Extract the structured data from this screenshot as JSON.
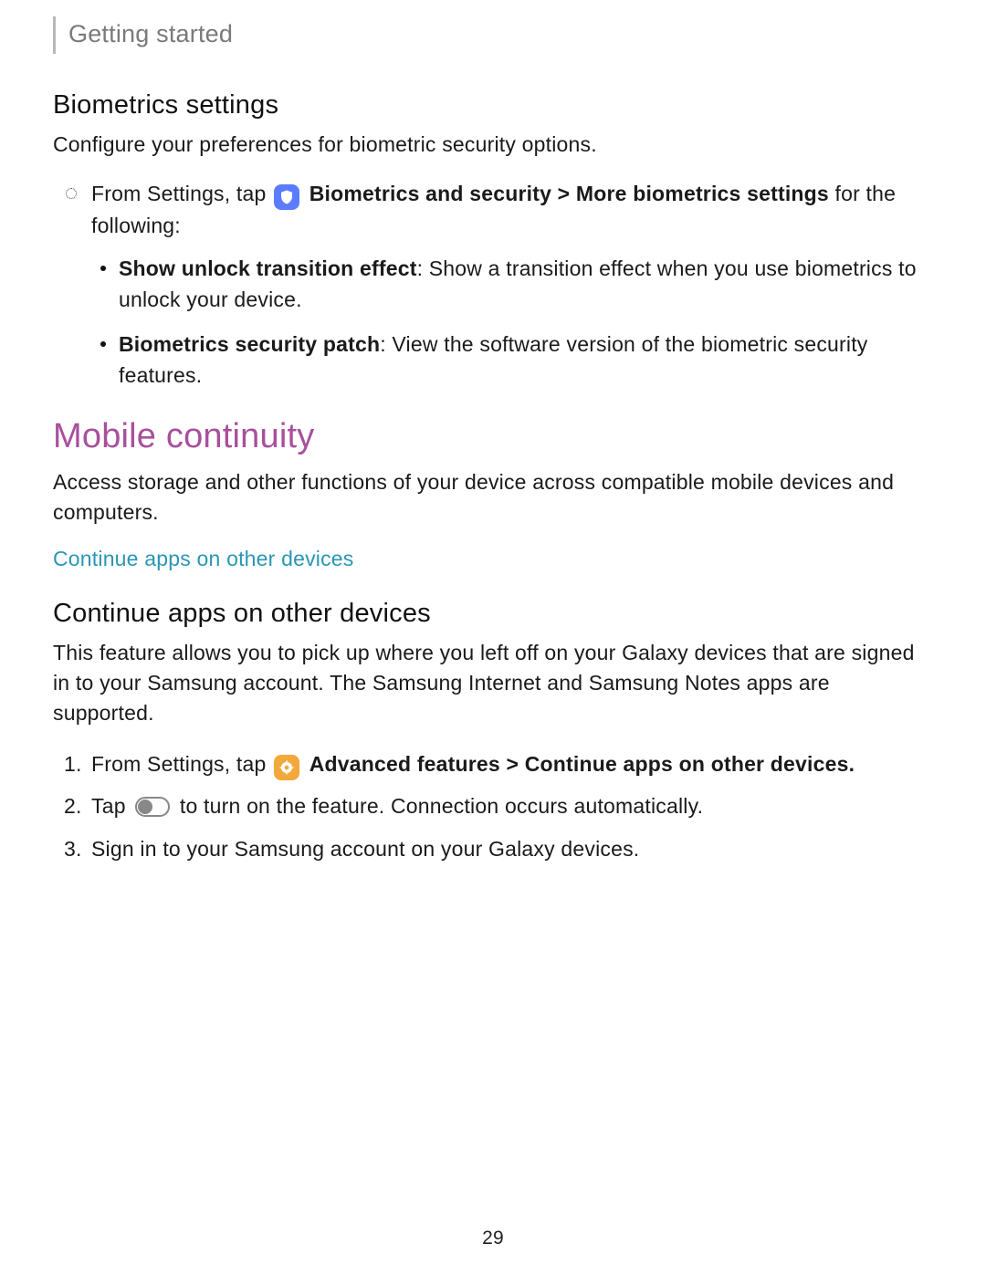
{
  "breadcrumb": "Getting started",
  "biometrics": {
    "heading": "Biometrics settings",
    "intro": "Configure your preferences for biometric security options.",
    "from_prefix": "From Settings, tap ",
    "path_strong": "Biometrics and security > More biometrics settings",
    "path_suffix": " for the following:",
    "items": [
      {
        "term": "Show unlock transition effect",
        "desc": ": Show a transition effect when you use biometrics to unlock your device."
      },
      {
        "term": "Biometrics security patch",
        "desc": ": View the software version of the biometric security features."
      }
    ]
  },
  "mobile": {
    "heading": "Mobile continuity",
    "intro": "Access storage and other functions of your device across compatible mobile devices and computers.",
    "link": "Continue apps on other devices"
  },
  "continue": {
    "heading": "Continue apps on other devices",
    "intro": "This feature allows you to pick up where you left off on your Galaxy devices that are signed in to your Samsung account. The Samsung Internet and Samsung Notes apps are supported.",
    "step1_prefix": "From Settings, tap ",
    "step1_strong": "Advanced features > Continue apps on other devices.",
    "step2_prefix": "Tap ",
    "step2_suffix": " to turn on the feature. Connection occurs automatically.",
    "step3": "Sign in to your Samsung account on your Galaxy devices."
  },
  "page_number": "29"
}
